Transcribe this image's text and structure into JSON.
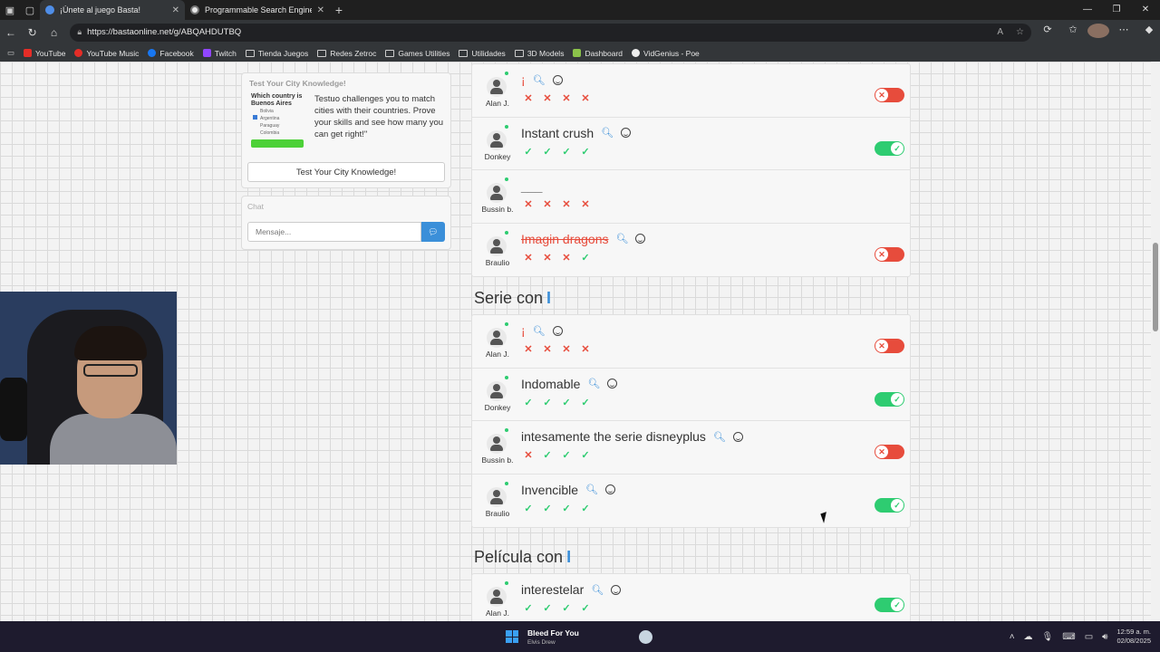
{
  "browser": {
    "tabs": [
      {
        "title": "¡Únete al juego Basta!",
        "active": true
      },
      {
        "title": "Programmable Search Engine",
        "active": false
      }
    ],
    "url": "https://bastaonline.net/g/ABQAHDUTBQ",
    "bookmarks": [
      "YouTube",
      "YouTube Music",
      "Facebook",
      "Twitch",
      "Tienda Juegos",
      "Redes Zetroc",
      "Games Utilities",
      "Utilidades",
      "3D Models",
      "Dashboard",
      "VidGenius - Poe"
    ]
  },
  "promo": {
    "title": "Test Your City Knowledge!",
    "thumb_question": "Which country is Buenos Aires",
    "thumb_options": [
      "Bolivia",
      "Argentina",
      "Paraguay",
      "Colombia"
    ],
    "text": "Testuo challenges you to match cities with their countries. Prove your skills and see how many you can get right!\"",
    "button": "Test Your City Knowledge!"
  },
  "chat": {
    "title": "Chat",
    "placeholder": "Mensaje..."
  },
  "categories": [
    {
      "title": "",
      "answers": [
        {
          "user": "Alan J.",
          "answer": "¡",
          "style": "red",
          "icons": true,
          "votes": [
            "no",
            "no",
            "no",
            "no"
          ],
          "toggle": "off"
        },
        {
          "user": "Donkey",
          "answer": "Instant crush",
          "style": "",
          "icons": true,
          "votes": [
            "ok",
            "ok",
            "ok",
            "ok"
          ],
          "toggle": "on"
        },
        {
          "user": "Bussin b.",
          "answer": "___",
          "style": "dash",
          "icons": false,
          "votes": [
            "no",
            "no",
            "no",
            "no"
          ],
          "toggle": "none"
        },
        {
          "user": "Braulio",
          "answer": "Imagin dragons",
          "style": "strike",
          "icons": true,
          "votes": [
            "no",
            "no",
            "no",
            "ok"
          ],
          "toggle": "off"
        }
      ]
    },
    {
      "title": "Serie con",
      "answers": [
        {
          "user": "Alan J.",
          "answer": "¡",
          "style": "red",
          "icons": true,
          "votes": [
            "no",
            "no",
            "no",
            "no"
          ],
          "toggle": "off"
        },
        {
          "user": "Donkey",
          "answer": "Indomable",
          "style": "",
          "icons": true,
          "votes": [
            "ok",
            "ok",
            "ok",
            "ok"
          ],
          "toggle": "on"
        },
        {
          "user": "Bussin b.",
          "answer": "intesamente the serie disneyplus",
          "style": "",
          "icons": true,
          "votes": [
            "no",
            "ok",
            "ok",
            "ok"
          ],
          "toggle": "off"
        },
        {
          "user": "Braulio",
          "answer": "Invencible",
          "style": "",
          "icons": true,
          "votes": [
            "ok",
            "ok",
            "ok",
            "ok"
          ],
          "toggle": "on"
        }
      ]
    },
    {
      "title": "Película con",
      "answers": [
        {
          "user": "Alan J.",
          "answer": "interestelar",
          "style": "",
          "icons": true,
          "votes": [
            "ok",
            "ok",
            "ok",
            "ok"
          ],
          "toggle": "on"
        }
      ]
    }
  ],
  "category_letter": "I",
  "taskbar": {
    "song_title": "Bleed For You",
    "song_artist": "Elvis Drew",
    "time": "12:59 a. m.",
    "date": "02/08/2025"
  },
  "colors": {
    "accent": "#3b8fd9",
    "ok": "#2ecc71",
    "no": "#e74c3c"
  }
}
